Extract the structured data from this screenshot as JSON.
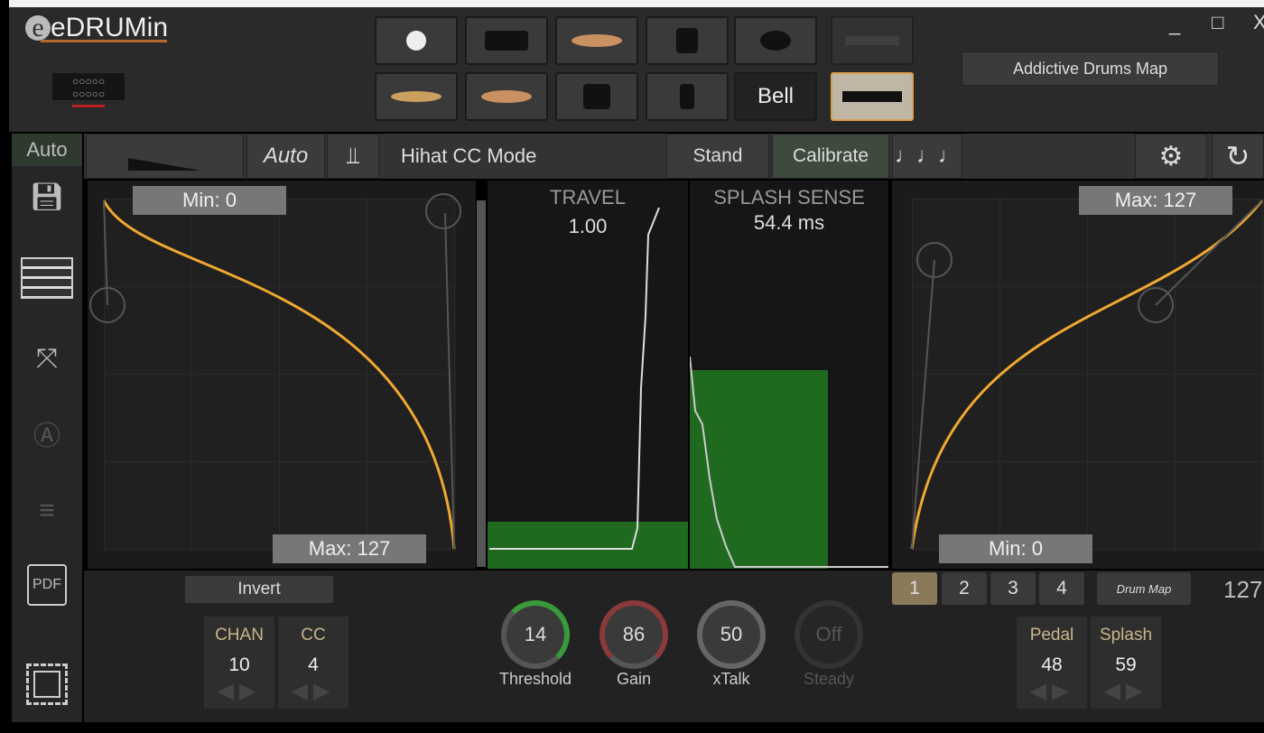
{
  "app": {
    "logo": "eDRUMin",
    "window_controls": {
      "minimize": "_",
      "maximize": "□",
      "close": "X"
    }
  },
  "pads": {
    "row2_text_pad": "Bell",
    "map_button": "Addictive Drums Map"
  },
  "toolbar": {
    "sidebar_auto": "Auto",
    "auto": "Auto",
    "mode": "Hihat CC Mode",
    "stand": "Stand",
    "calibrate": "Calibrate",
    "notes_icon": "♩♩♩",
    "gear_icon": "⚙",
    "refresh_icon": "↻"
  },
  "left_curve": {
    "min_label": "Min: 0",
    "max_label": "Max: 127"
  },
  "right_curve": {
    "min_label": "Min: 0",
    "max_label": "Max: 127"
  },
  "travel": {
    "title": "TRAVEL",
    "value": "1.00"
  },
  "splash": {
    "title": "SPLASH SENSE",
    "value": "54.4 ms"
  },
  "bottom": {
    "invert": "Invert",
    "chan": {
      "label": "CHAN",
      "value": "10"
    },
    "cc": {
      "label": "CC",
      "value": "4"
    },
    "knobs": [
      {
        "label": "Threshold",
        "value": "14",
        "color": "#3a9a3a"
      },
      {
        "label": "Gain",
        "value": "86",
        "color": "#8a3a3a"
      },
      {
        "label": "xTalk",
        "value": "50",
        "color": "#666666"
      },
      {
        "label": "Steady",
        "value": "Off",
        "color": "#333333"
      }
    ],
    "pages": [
      "1",
      "2",
      "3",
      "4"
    ],
    "drum_map": "Drum Map",
    "readout": "127",
    "pedal": {
      "label": "Pedal",
      "value": "48"
    },
    "splash": {
      "label": "Splash",
      "value": "59"
    }
  },
  "colors": {
    "curve": "#f0a830",
    "meter": "#1f6a1f",
    "selected": "#d9a050"
  }
}
